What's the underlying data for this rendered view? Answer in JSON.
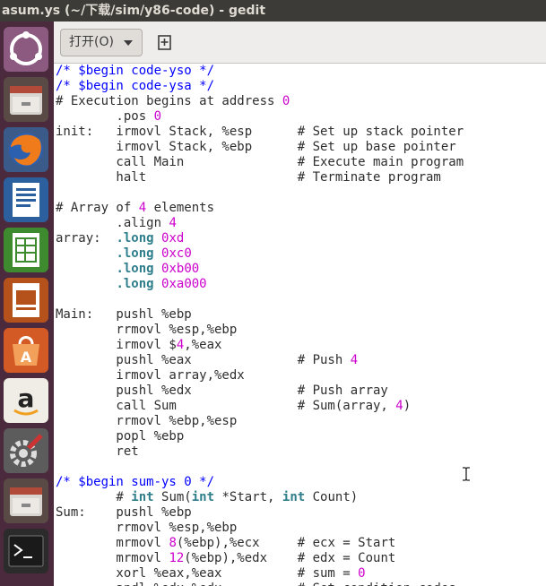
{
  "window": {
    "title": "asum.ys (~/下载/sim/y86-code) - gedit"
  },
  "toolbar": {
    "open_label": "打开(O)"
  },
  "launcher": {
    "items": [
      {
        "name": "ubuntu-dash-icon"
      },
      {
        "name": "file-manager-icon"
      },
      {
        "name": "firefox-icon"
      },
      {
        "name": "libreoffice-writer-icon"
      },
      {
        "name": "libreoffice-calc-icon"
      },
      {
        "name": "libreoffice-impress-icon"
      },
      {
        "name": "software-center-icon"
      },
      {
        "name": "amazon-icon"
      },
      {
        "name": "system-settings-icon"
      },
      {
        "name": "file-manager-icon-2"
      },
      {
        "name": "terminal-icon"
      }
    ]
  },
  "code": {
    "lines": [
      [
        {
          "t": "/* $begin code-yso */",
          "s": "k"
        }
      ],
      [
        {
          "t": "/* $begin code-ysa */",
          "s": "k"
        }
      ],
      [
        {
          "t": "# Execution begins at address ",
          "s": "c"
        },
        {
          "t": "0",
          "s": "n"
        }
      ],
      [
        {
          "t": "        .pos ",
          "s": "c"
        },
        {
          "t": "0",
          "s": "n"
        }
      ],
      [
        {
          "t": "init:   irmovl Stack, %esp      # Set up stack pointer",
          "s": "c"
        }
      ],
      [
        {
          "t": "        irmovl Stack, %ebp      # Set up base pointer",
          "s": "c"
        }
      ],
      [
        {
          "t": "        call Main               # Execute main program",
          "s": "c"
        }
      ],
      [
        {
          "t": "        halt                    # Terminate program",
          "s": "c"
        }
      ],
      [
        {
          "t": "",
          "s": "c"
        }
      ],
      [
        {
          "t": "# Array of ",
          "s": "c"
        },
        {
          "t": "4",
          "s": "n"
        },
        {
          "t": " elements",
          "s": "c"
        }
      ],
      [
        {
          "t": "        .align ",
          "s": "c"
        },
        {
          "t": "4",
          "s": "n"
        }
      ],
      [
        {
          "t": "array:  ",
          "s": "c"
        },
        {
          "t": ".long",
          "s": "t"
        },
        {
          "t": " ",
          "s": "c"
        },
        {
          "t": "0xd",
          "s": "n"
        }
      ],
      [
        {
          "t": "        ",
          "s": "c"
        },
        {
          "t": ".long",
          "s": "t"
        },
        {
          "t": " ",
          "s": "c"
        },
        {
          "t": "0xc0",
          "s": "n"
        }
      ],
      [
        {
          "t": "        ",
          "s": "c"
        },
        {
          "t": ".long",
          "s": "t"
        },
        {
          "t": " ",
          "s": "c"
        },
        {
          "t": "0xb00",
          "s": "n"
        }
      ],
      [
        {
          "t": "        ",
          "s": "c"
        },
        {
          "t": ".long",
          "s": "t"
        },
        {
          "t": " ",
          "s": "c"
        },
        {
          "t": "0xa000",
          "s": "n"
        }
      ],
      [
        {
          "t": "",
          "s": "c"
        }
      ],
      [
        {
          "t": "Main:   pushl %ebp",
          "s": "c"
        }
      ],
      [
        {
          "t": "        rrmovl %esp,%ebp",
          "s": "c"
        }
      ],
      [
        {
          "t": "        irmovl $",
          "s": "c"
        },
        {
          "t": "4",
          "s": "n"
        },
        {
          "t": ",%eax",
          "s": "c"
        }
      ],
      [
        {
          "t": "        pushl %eax              # Push ",
          "s": "c"
        },
        {
          "t": "4",
          "s": "n"
        }
      ],
      [
        {
          "t": "        irmovl array,%edx",
          "s": "c"
        }
      ],
      [
        {
          "t": "        pushl %edx              # Push array",
          "s": "c"
        }
      ],
      [
        {
          "t": "        call Sum                # Sum(array, ",
          "s": "c"
        },
        {
          "t": "4",
          "s": "n"
        },
        {
          "t": ")",
          "s": "c"
        }
      ],
      [
        {
          "t": "        rrmovl %ebp,%esp",
          "s": "c"
        }
      ],
      [
        {
          "t": "        popl %ebp",
          "s": "c"
        }
      ],
      [
        {
          "t": "        ret",
          "s": "c"
        }
      ],
      [
        {
          "t": "",
          "s": "c"
        }
      ],
      [
        {
          "t": "/* $begin sum-ys 0 */",
          "s": "k"
        }
      ],
      [
        {
          "t": "        # ",
          "s": "c"
        },
        {
          "t": "int",
          "s": "kw"
        },
        {
          "t": " Sum(",
          "s": "c"
        },
        {
          "t": "int",
          "s": "kw"
        },
        {
          "t": " *Start, ",
          "s": "c"
        },
        {
          "t": "int",
          "s": "kw"
        },
        {
          "t": " Count)",
          "s": "c"
        }
      ],
      [
        {
          "t": "Sum:    pushl %ebp",
          "s": "c"
        }
      ],
      [
        {
          "t": "        rrmovl %esp,%ebp",
          "s": "c"
        }
      ],
      [
        {
          "t": "        mrmovl ",
          "s": "c"
        },
        {
          "t": "8",
          "s": "n"
        },
        {
          "t": "(%ebp),%ecx     # ecx = Start",
          "s": "c"
        }
      ],
      [
        {
          "t": "        mrmovl ",
          "s": "c"
        },
        {
          "t": "12",
          "s": "n"
        },
        {
          "t": "(%ebp),%edx    # edx = Count",
          "s": "c"
        }
      ],
      [
        {
          "t": "        xorl %eax,%eax          # sum = ",
          "s": "c"
        },
        {
          "t": "0",
          "s": "n"
        }
      ],
      [
        {
          "t": "        andl %edx,%edx          # Set condition codes",
          "s": "c"
        }
      ]
    ]
  },
  "colors": {
    "launcher_bg": "#4a2a3c",
    "comment_blue": "#0000ff",
    "number_magenta": "#cc00cc"
  }
}
